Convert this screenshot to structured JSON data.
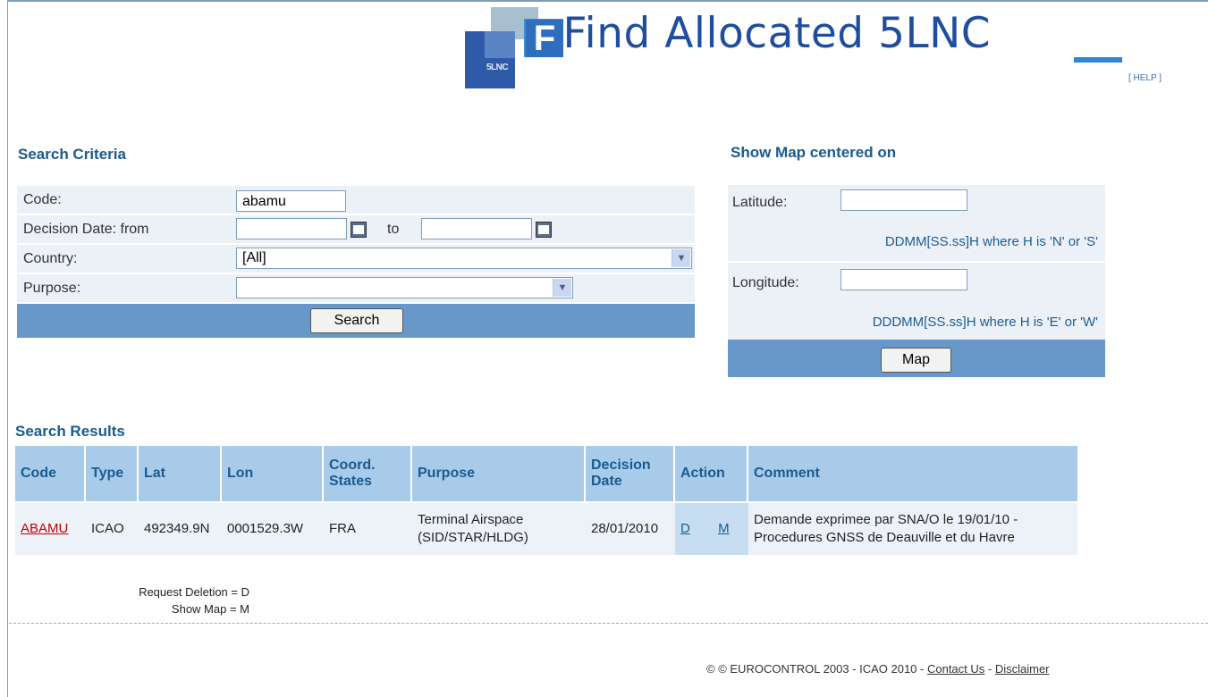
{
  "header": {
    "title": "Find Allocated 5LNC",
    "help_label": "[ HELP ]",
    "logo_small_text": "5LNC"
  },
  "search": {
    "heading": "Search Criteria",
    "code_label": "Code:",
    "code_value": "abamu",
    "decision_label": "Decision Date:  from",
    "to_label": "to",
    "from_value": "",
    "to_value": "",
    "country_label": "Country:",
    "country_value": "[All]",
    "purpose_label": "Purpose:",
    "purpose_value": "",
    "search_button": "Search"
  },
  "map": {
    "heading": "Show Map centered on",
    "latitude_label": "Latitude:",
    "latitude_value": "",
    "latitude_hint": "DDMM[SS.ss]H where H is 'N' or 'S'",
    "longitude_label": "Longitude:",
    "longitude_value": "",
    "longitude_hint": "DDDMM[SS.ss]H where H is 'E' or 'W'",
    "map_button": "Map"
  },
  "results": {
    "heading": "Search Results",
    "columns": {
      "code": "Code",
      "type": "Type",
      "lat": "Lat",
      "lon": "Lon",
      "coord1": "Coord.",
      "coord2": "States",
      "purpose": "Purpose",
      "decision1": "Decision",
      "decision2": "Date",
      "action": "Action",
      "comment": "Comment"
    },
    "rows": [
      {
        "code": "ABAMU",
        "type": "ICAO",
        "lat": "492349.9N",
        "lon": "0001529.3W",
        "coord_states": "FRA",
        "purpose1": "Terminal Airspace",
        "purpose2": "(SID/STAR/HLDG)",
        "decision_date": "28/01/2010",
        "action_d": "D",
        "action_m": "M",
        "comment1": "Demande exprimee par SNA/O le 19/01/10 -",
        "comment2": "Procedures GNSS de Deauville et du Havre"
      }
    ]
  },
  "legend": {
    "line1": "Request Deletion = D",
    "line2": "Show Map = M"
  },
  "footer": {
    "text": "© © EUROCONTROL 2003 - ICAO 2010 - ",
    "contact": "Contact Us",
    "sep": " - ",
    "disclaimer": "Disclaimer"
  }
}
